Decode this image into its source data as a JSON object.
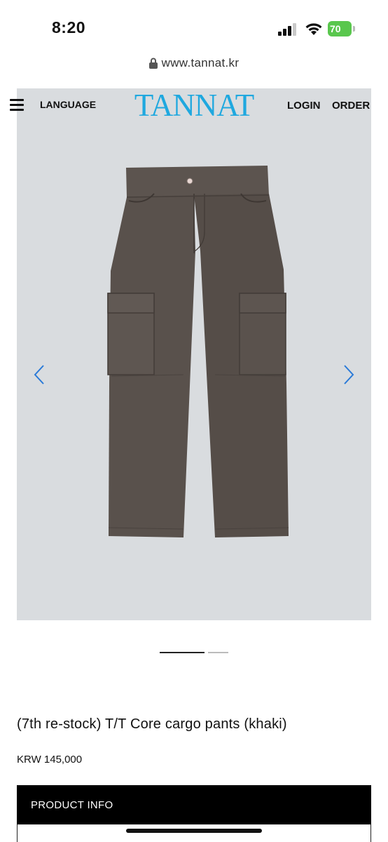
{
  "status_bar": {
    "time": "8:20",
    "battery": "70"
  },
  "browser": {
    "url": "www.tannat.kr"
  },
  "header": {
    "language_label": "LANGUAGE",
    "logo": "TANNAT",
    "login_label": "LOGIN",
    "order_label": "ORDER"
  },
  "gallery": {
    "slide_count": 2,
    "active_slide": 1
  },
  "product": {
    "title": "(7th re-stock) T/T Core cargo pants (khaki)",
    "price": "KRW 145,000",
    "info_label": "PRODUCT INFO"
  },
  "colors": {
    "brand": "#1fa8df",
    "arrow": "#2a7ad8",
    "pants": "#5a524d",
    "background_photo": "#d9dcdf"
  }
}
